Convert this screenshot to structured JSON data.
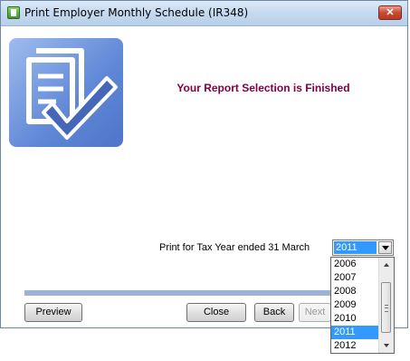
{
  "window": {
    "title": "Print Employer Monthly Schedule (IR348)",
    "close_glyph": "✕"
  },
  "icons": {
    "app": "app-icon",
    "close": "close-icon",
    "wizard": "document-checkmark-icon",
    "dropdown": "chevron-down-icon"
  },
  "main": {
    "heading": "Your Report Selection is Finished",
    "year_label": "Print for Tax Year ended 31 March",
    "selected_year": "2011"
  },
  "dropdown": {
    "options": [
      "2006",
      "2007",
      "2008",
      "2009",
      "2010",
      "2011",
      "2012"
    ],
    "selected_index": 5
  },
  "buttons": {
    "preview": "Preview",
    "close": "Close",
    "back": "Back",
    "next": "Next"
  },
  "colors": {
    "heading": "#800040",
    "selection": "#3399ff",
    "progress": "#9bb3d6"
  }
}
